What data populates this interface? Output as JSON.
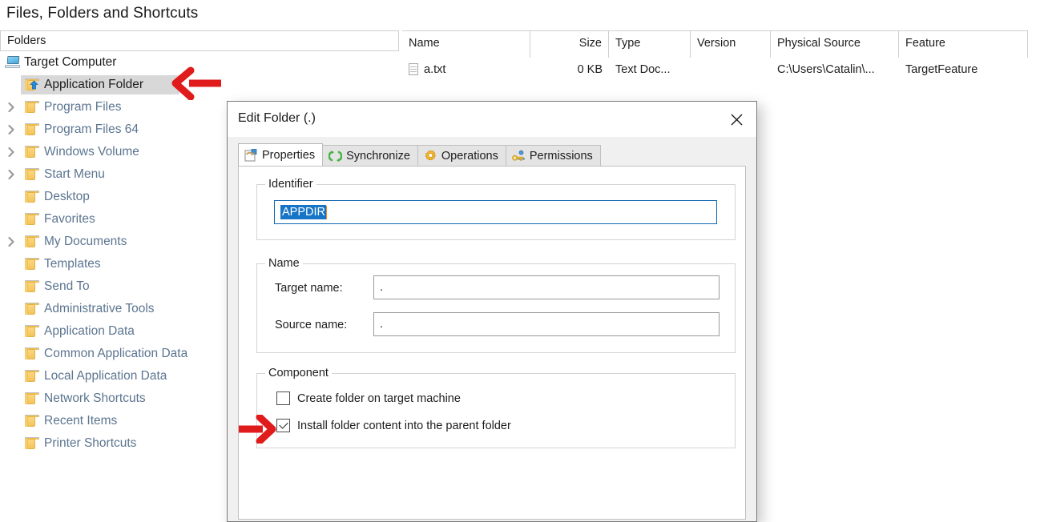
{
  "page": {
    "title": "Files, Folders and Shortcuts"
  },
  "folders_pane": {
    "header_label": "Folders",
    "tree": [
      {
        "label": "Target Computer",
        "icon": "computer-icon",
        "depth": 0,
        "expander": "none",
        "selected": false
      },
      {
        "label": "Application Folder",
        "icon": "app-folder-icon",
        "depth": 1,
        "expander": "none",
        "selected": true
      },
      {
        "label": "Program Files",
        "icon": "folder-icon",
        "depth": 1,
        "expander": "collapsed",
        "selected": false
      },
      {
        "label": "Program Files 64",
        "icon": "folder-icon",
        "depth": 1,
        "expander": "collapsed",
        "selected": false
      },
      {
        "label": "Windows Volume",
        "icon": "folder-icon",
        "depth": 1,
        "expander": "collapsed",
        "selected": false
      },
      {
        "label": "Start Menu",
        "icon": "folder-icon",
        "depth": 1,
        "expander": "collapsed",
        "selected": false
      },
      {
        "label": "Desktop",
        "icon": "folder-icon",
        "depth": 1,
        "expander": "none",
        "selected": false
      },
      {
        "label": "Favorites",
        "icon": "folder-icon",
        "depth": 1,
        "expander": "none",
        "selected": false
      },
      {
        "label": "My Documents",
        "icon": "folder-icon",
        "depth": 1,
        "expander": "collapsed",
        "selected": false
      },
      {
        "label": "Templates",
        "icon": "folder-icon",
        "depth": 1,
        "expander": "none",
        "selected": false
      },
      {
        "label": "Send To",
        "icon": "folder-icon",
        "depth": 1,
        "expander": "none",
        "selected": false
      },
      {
        "label": "Administrative Tools",
        "icon": "folder-icon",
        "depth": 1,
        "expander": "none",
        "selected": false
      },
      {
        "label": "Application Data",
        "icon": "folder-icon",
        "depth": 1,
        "expander": "none",
        "selected": false
      },
      {
        "label": "Common Application Data",
        "icon": "folder-icon",
        "depth": 1,
        "expander": "none",
        "selected": false
      },
      {
        "label": "Local Application Data",
        "icon": "folder-icon",
        "depth": 1,
        "expander": "none",
        "selected": false
      },
      {
        "label": "Network Shortcuts",
        "icon": "folder-icon",
        "depth": 1,
        "expander": "none",
        "selected": false
      },
      {
        "label": "Recent Items",
        "icon": "folder-icon",
        "depth": 1,
        "expander": "none",
        "selected": false
      },
      {
        "label": "Printer Shortcuts",
        "icon": "folder-icon",
        "depth": 1,
        "expander": "none",
        "selected": false
      }
    ]
  },
  "file_list": {
    "columns": [
      {
        "label": "Name",
        "align": "left"
      },
      {
        "label": "Size",
        "align": "right"
      },
      {
        "label": "Type",
        "align": "left"
      },
      {
        "label": "Version",
        "align": "left"
      },
      {
        "label": "Physical Source",
        "align": "left"
      },
      {
        "label": "Feature",
        "align": "left"
      }
    ],
    "rows": [
      {
        "icon": "text-file-icon",
        "name": "a.txt",
        "size": "0 KB",
        "type": "Text Doc...",
        "version": "",
        "physical_source": "C:\\Users\\Catalin\\...",
        "feature": "TargetFeature"
      }
    ]
  },
  "dialog": {
    "title": "Edit Folder (.)",
    "close_label": "✕",
    "tabs": [
      {
        "label": "Properties",
        "icon": "properties-icon",
        "active": true
      },
      {
        "label": "Synchronize",
        "icon": "synchronize-icon",
        "active": false
      },
      {
        "label": "Operations",
        "icon": "operations-icon",
        "active": false
      },
      {
        "label": "Permissions",
        "icon": "permissions-icon",
        "active": false
      }
    ],
    "identifier_group": {
      "legend": "Identifier",
      "value": "APPDIR",
      "selected": true
    },
    "name_group": {
      "legend": "Name",
      "fields": [
        {
          "label": "Target name:",
          "value": "."
        },
        {
          "label": "Source name:",
          "value": "."
        }
      ]
    },
    "component_group": {
      "legend": "Component",
      "checkboxes": [
        {
          "label": "Create folder on target machine",
          "checked": false
        },
        {
          "label": "Install folder content into the parent folder",
          "checked": true
        }
      ]
    }
  },
  "annotations": {
    "arrow_color": "#e01b1b",
    "arrow_tree_target": "Application Folder",
    "arrow_checkbox_target": "Install folder content into the parent folder"
  }
}
